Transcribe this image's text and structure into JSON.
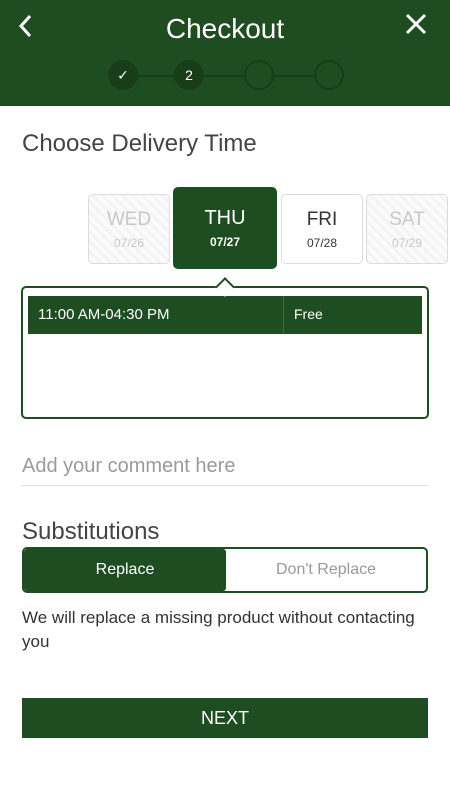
{
  "header": {
    "title": "Checkout",
    "back_icon": "chevron-left-icon",
    "close_icon": "close-icon",
    "steps": [
      {
        "label": "✓",
        "state": "done"
      },
      {
        "label": "2",
        "state": "current"
      },
      {
        "label": "",
        "state": "upcoming"
      },
      {
        "label": "",
        "state": "upcoming"
      }
    ]
  },
  "delivery": {
    "title": "Choose Delivery Time",
    "days": [
      {
        "name": "WED",
        "date": "07/26",
        "state": "disabled"
      },
      {
        "name": "THU",
        "date": "07/27",
        "state": "selected"
      },
      {
        "name": "FRI",
        "date": "07/28",
        "state": "available"
      },
      {
        "name": "SAT",
        "date": "07/29",
        "state": "disabled"
      }
    ],
    "slots": [
      {
        "time": "11:00 AM-04:30 PM",
        "price": "Free",
        "selected": true
      }
    ]
  },
  "comment": {
    "placeholder": "Add your comment here",
    "value": ""
  },
  "substitutions": {
    "title": "Substitutions",
    "options": [
      "Replace",
      "Don't Replace"
    ],
    "selected": "Replace",
    "note": "We will replace a missing product without contacting you"
  },
  "actions": {
    "next_label": "NEXT"
  },
  "colors": {
    "primary": "#1f4d22",
    "primary_dark": "#173d19",
    "disabled_text": "#c8c8c8"
  }
}
